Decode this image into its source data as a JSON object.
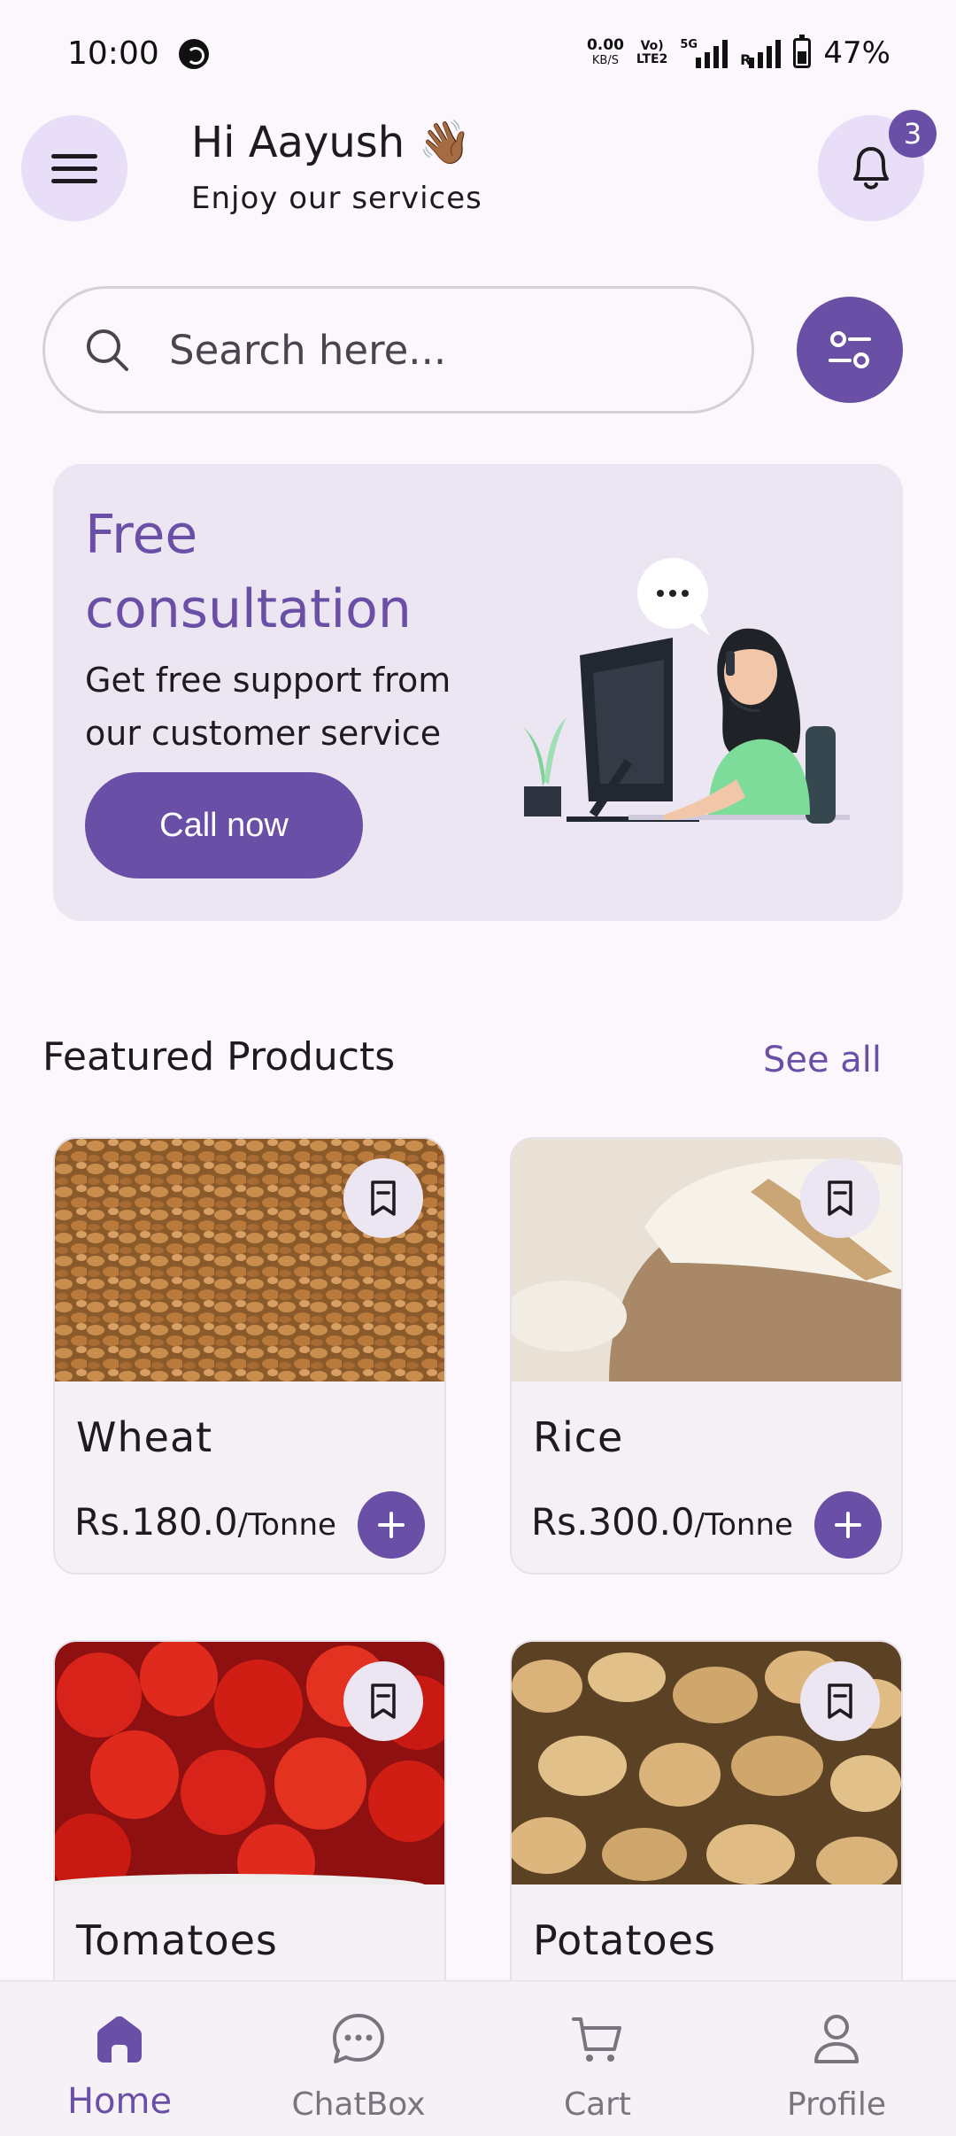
{
  "status_bar": {
    "time": "10:00",
    "net_speed_value": "0.00",
    "net_speed_unit": "KB/S",
    "volte_line1": "Vo)",
    "volte_line2": "LTE2",
    "net_type": "5G",
    "roaming": "R",
    "battery": "47%"
  },
  "header": {
    "greeting": "Hi Aayush 👋🏾",
    "subtitle": "Enjoy our services",
    "notification_count": "3"
  },
  "search": {
    "placeholder": "Search here..."
  },
  "banner": {
    "title": "Free consultation",
    "text": "Get free support from our customer service",
    "button": "Call now"
  },
  "featured": {
    "title": "Featured Products",
    "see_all": "See all",
    "products": [
      {
        "name": "Wheat",
        "price": "Rs.180.0",
        "unit": "/Tonne"
      },
      {
        "name": "Rice",
        "price": "Rs.300.0",
        "unit": "/Tonne"
      },
      {
        "name": "Tomatoes"
      },
      {
        "name": "Potatoes"
      }
    ]
  },
  "nav": {
    "items": [
      {
        "label": "Home",
        "icon": "home-icon"
      },
      {
        "label": "ChatBox",
        "icon": "chat-icon"
      },
      {
        "label": "Cart",
        "icon": "cart-icon"
      },
      {
        "label": "Profile",
        "icon": "profile-icon"
      }
    ]
  },
  "colors": {
    "accent": "#6a4fa7",
    "accent_light": "#e9def8",
    "background": "#fcf7fc"
  }
}
